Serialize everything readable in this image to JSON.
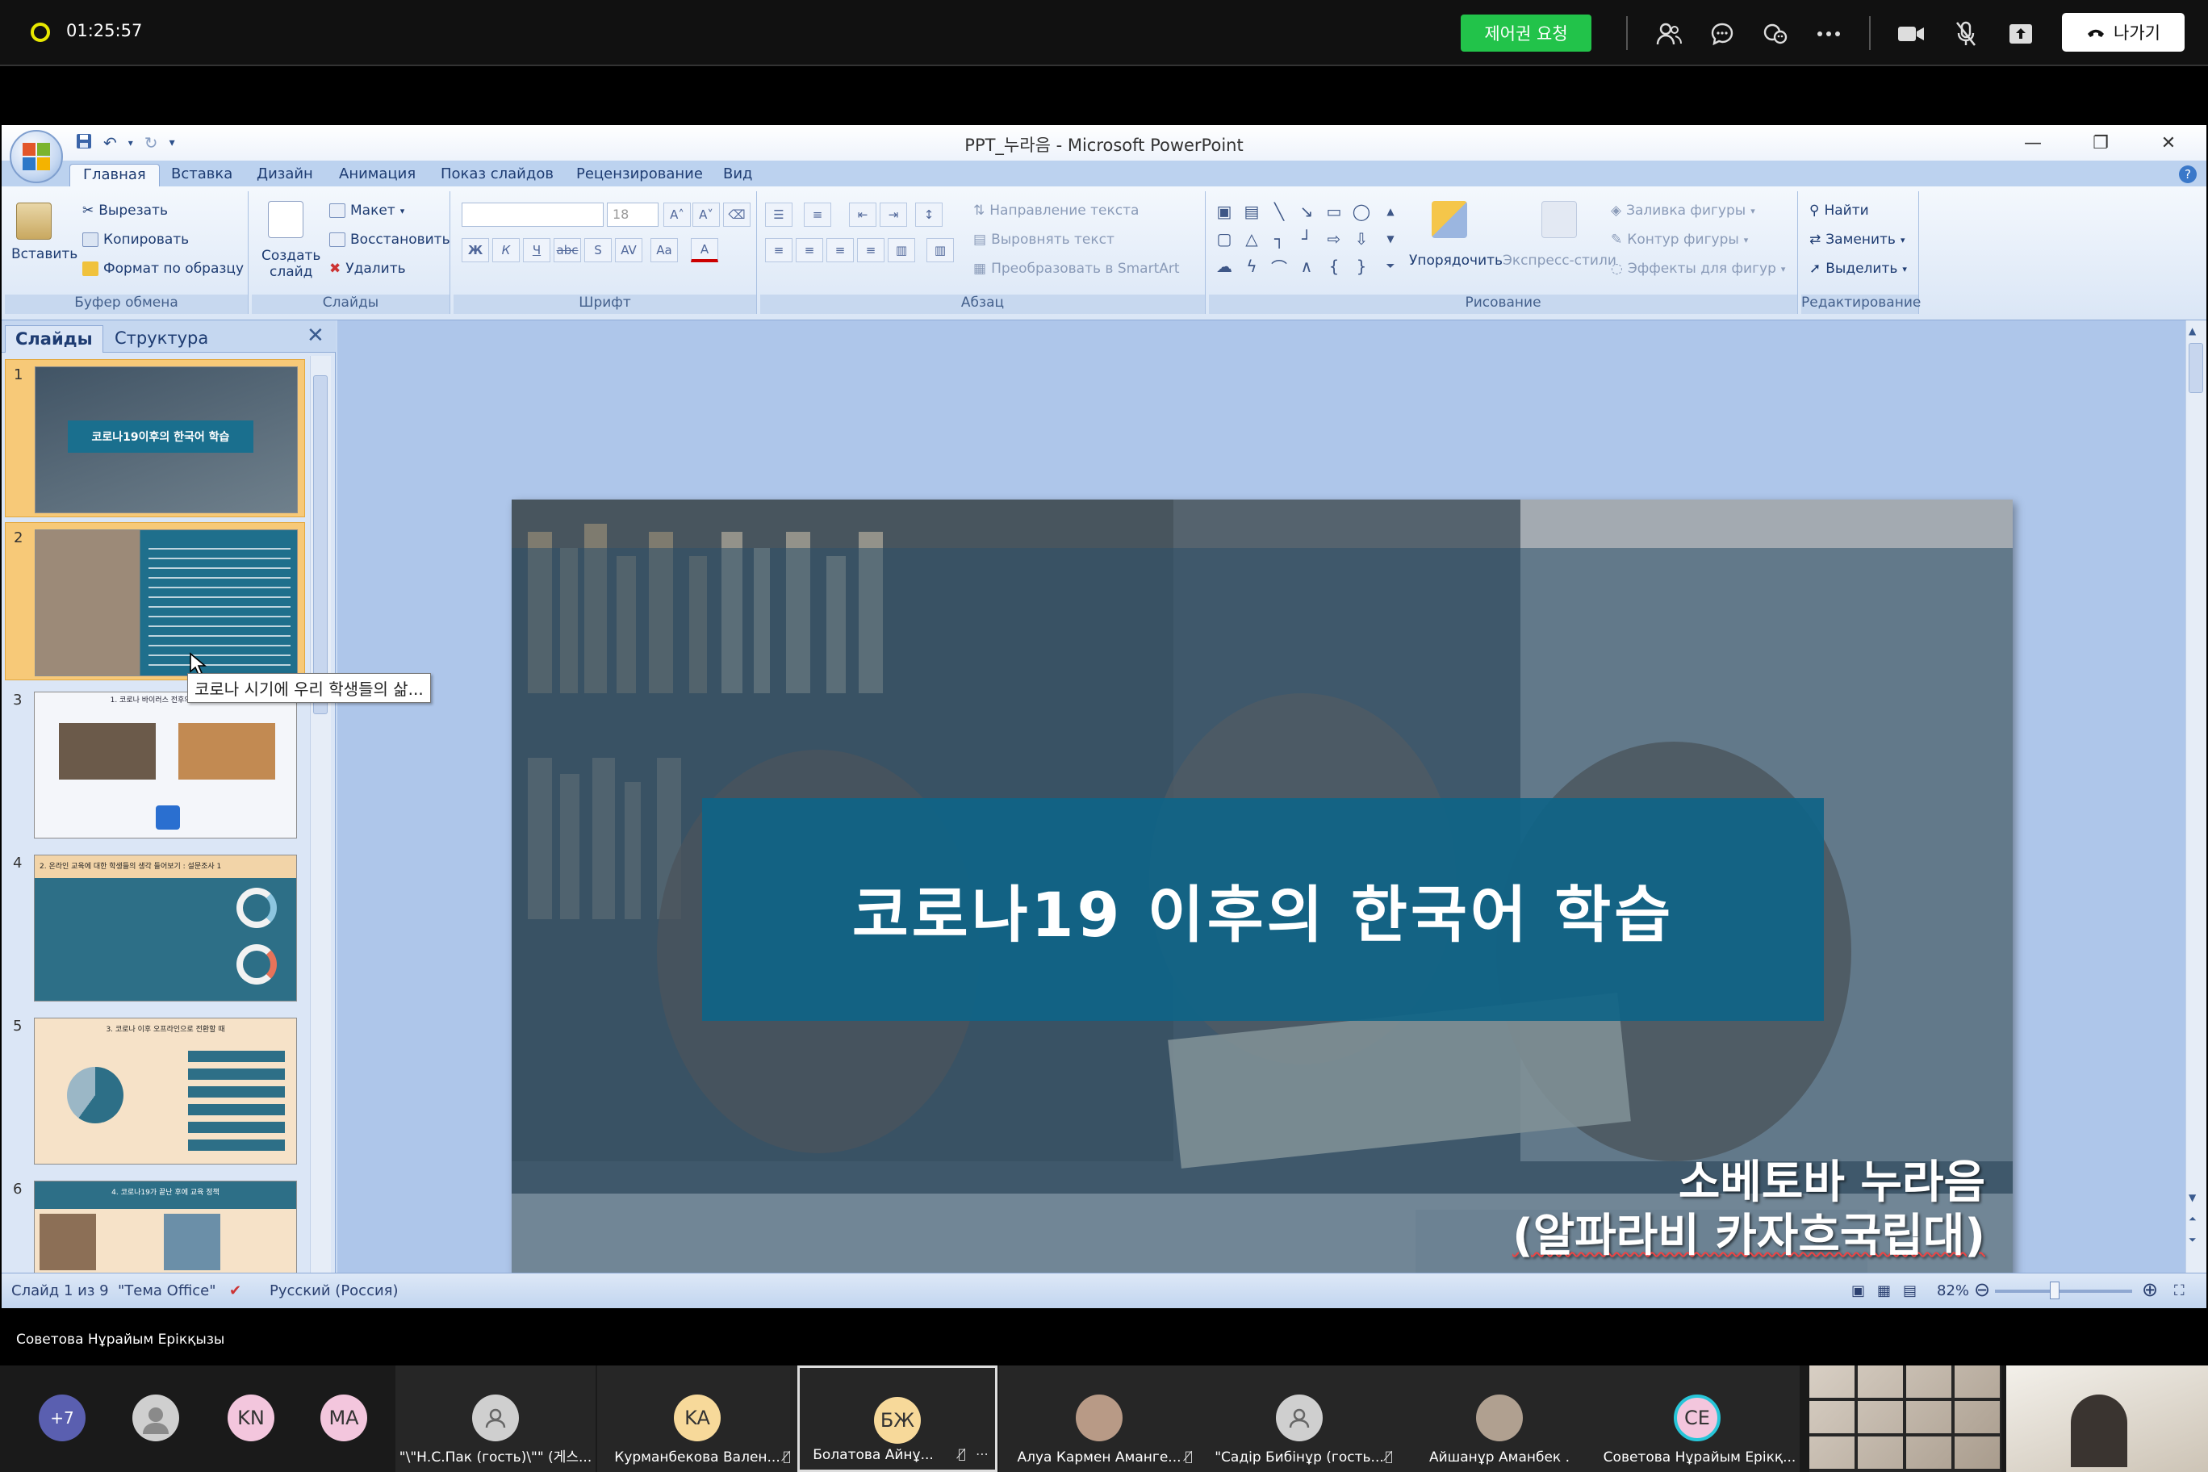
{
  "meeting": {
    "elapsed": "01:25:57",
    "control_request_label": "제어권 요청",
    "leave_label": "나가기",
    "presenter_name": "Советова Нұрайым Ерікқызы",
    "more_count": "+7",
    "participants": [
      {
        "initials": "KN",
        "color": "#f3c6dd",
        "name": ""
      },
      {
        "initials": "MA",
        "color": "#f3c6dd",
        "name": ""
      },
      {
        "initials": "",
        "color": "#cfcfcf",
        "name": "\"\\\"Н.С.Пак (гость)\\\"\" (게스..."
      },
      {
        "initials": "KA",
        "color": "#f7d99a",
        "name": "Курманбекова Вален..."
      },
      {
        "initials": "БЖ",
        "color": "#f7d99a",
        "name": "Болатова Айнұ..."
      },
      {
        "initials": "",
        "color": "#b89a86",
        "name": "Алуа Кармен Аманге..."
      },
      {
        "initials": "",
        "color": "#cfcfcf",
        "name": "\"Садір Бибінұр (гость..."
      },
      {
        "initials": "",
        "color": "#b0a090",
        "name": "Айшанұр Аманбек ."
      },
      {
        "initials": "CE",
        "color": "#f3c6dd",
        "name": "Советова Нұрайым Ерікқ..."
      }
    ]
  },
  "ppt": {
    "title": "PPT_누라음 - Microsoft PowerPoint",
    "tabs": [
      "Главная",
      "Вставка",
      "Дизайн",
      "Анимация",
      "Показ слайдов",
      "Рецензирование",
      "Вид"
    ],
    "clipboard": {
      "paste": "Вставить",
      "cut": "Вырезать",
      "copy": "Копировать",
      "format": "Формат по образцу",
      "label": "Буфер обмена"
    },
    "slides_group": {
      "create": "Создать",
      "create2": "слайд",
      "layout": "Макет",
      "restore": "Восстановить",
      "delete": "Удалить",
      "label": "Слайды"
    },
    "font_group": {
      "size": "18",
      "label": "Шрифт"
    },
    "paragraph_group": {
      "direction": "Направление текста",
      "align": "Выровнять текст",
      "smartart": "Преобразовать в SmartArt",
      "label": "Абзац"
    },
    "drawing_group": {
      "arrange": "Упорядочить",
      "quick_styles": "Экспресс-стили",
      "fill": "Заливка фигуры",
      "outline": "Контур фигуры",
      "effects": "Эффекты для фигур",
      "label": "Рисование"
    },
    "editing_group": {
      "find": "Найти",
      "replace": "Заменить",
      "select": "Выделить",
      "label": "Редактирование"
    },
    "panel_tabs": [
      "Слайды",
      "Структура"
    ],
    "tooltip": "코로나 시기에 우리 학생들의 삶...",
    "slide": {
      "title": "코로나19 이후의 한국어 학습",
      "author_line1": "소베토바 누라음",
      "author_line2": "(알파라비 카자흐국립대)"
    },
    "thumbs": [
      {
        "num": "1",
        "caption": "코로나19이후의 한국어 학습"
      },
      {
        "num": "2",
        "caption": ""
      },
      {
        "num": "3",
        "caption": "1. 코로나 바이러스 전후의 학교 생활"
      },
      {
        "num": "4",
        "caption": "2. 온라인 교육에 대한 학생들의 생각 들어보기 : 설문조사 1"
      },
      {
        "num": "5",
        "caption": "3. 코로나 이후 오프라인으로 전환할 때"
      },
      {
        "num": "6",
        "caption": "4. 코로나19가 끝난 후에 교육 정책"
      }
    ],
    "status": {
      "slide_of": "Слайд 1 из 9",
      "theme": "\"Тема Office\"",
      "language": "Русский (Россия)",
      "zoom": "82%"
    }
  }
}
